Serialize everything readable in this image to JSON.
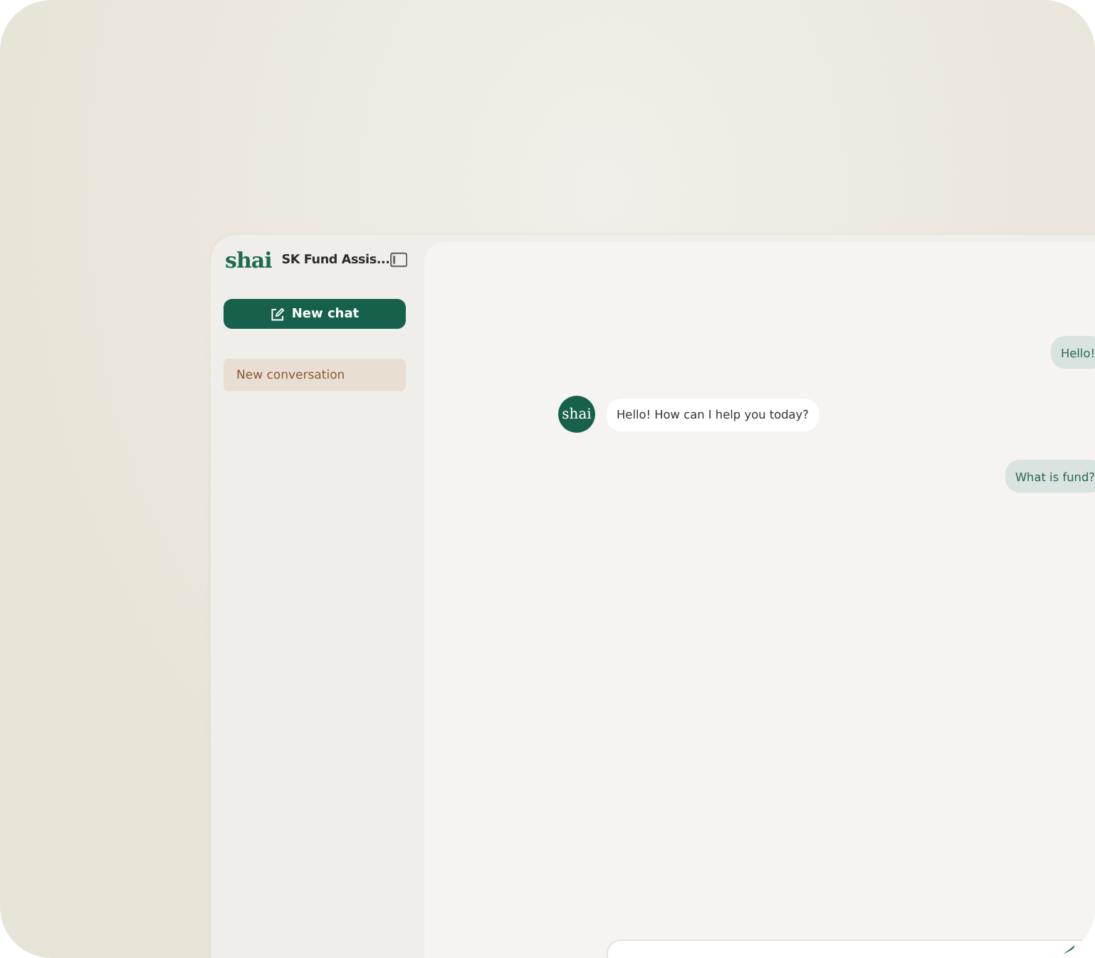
{
  "sidebar": {
    "logo": "shai",
    "title": "SK Fund Assis...",
    "new_chat_button": "New chat",
    "conversations": [
      {
        "label": "New conversation",
        "selected": true
      }
    ]
  },
  "messages": [
    {
      "kind": "user",
      "text": "Hello!"
    },
    {
      "kind": "assistant",
      "avatar": "shai",
      "text": "Hello! How can I help you today?"
    },
    {
      "kind": "user",
      "text": "What is fund?"
    }
  ]
}
